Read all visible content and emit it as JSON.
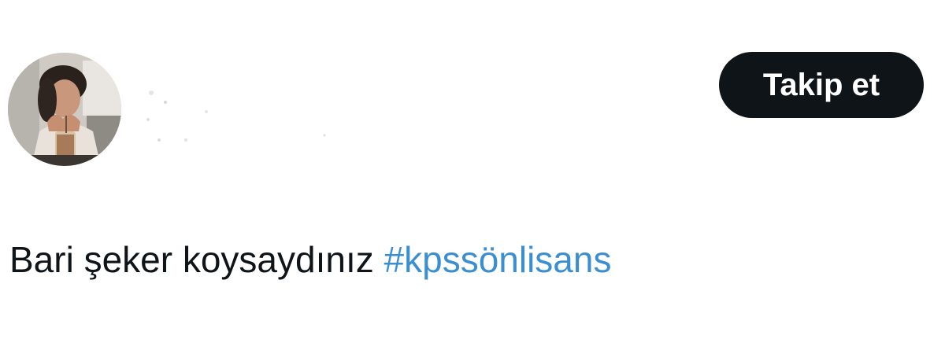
{
  "user": {
    "avatar_icon": "profile-photo",
    "display_name": ""
  },
  "follow_button": {
    "label": "Takip et",
    "bg_color": "#0f1419",
    "text_color": "#ffffff"
  },
  "tweet": {
    "text": "Bari şeker koysaydınız ",
    "hashtag": "#kpssönlisans",
    "hashtag_color": "#3b8fd1"
  }
}
